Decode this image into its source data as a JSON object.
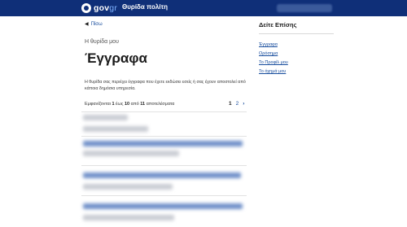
{
  "header": {
    "logo_text": "gov",
    "logo_suffix": "gr",
    "app_title": "Θυρίδα πολίτη"
  },
  "back": {
    "label": "Πίσω"
  },
  "page": {
    "eyebrow": "Η θυρίδα μου",
    "title": "Έγγραφα",
    "description": "Η θυρίδα σας περιέχει έγγραφα που έχετε εκδώσει εσείς ή σας έχουν αποστολεί από κάποια δημόσια υπηρεσία."
  },
  "results": {
    "prefix": "Εμφανίζονται",
    "from": "1",
    "mid": "έως",
    "to": "10",
    "of_word": "από",
    "total": "11",
    "suffix": "αποτελέσματα"
  },
  "pagination": {
    "pages": [
      "1",
      "2"
    ],
    "current": "1"
  },
  "aside": {
    "title": "Δείτε Επίσης",
    "links": [
      "Έγγραφα",
      "Ορόσημα",
      "Το Προφίλ μου",
      "Το όχημά μου"
    ]
  },
  "colors": {
    "header_bg": "#0f2f78",
    "link": "#154b9c"
  }
}
